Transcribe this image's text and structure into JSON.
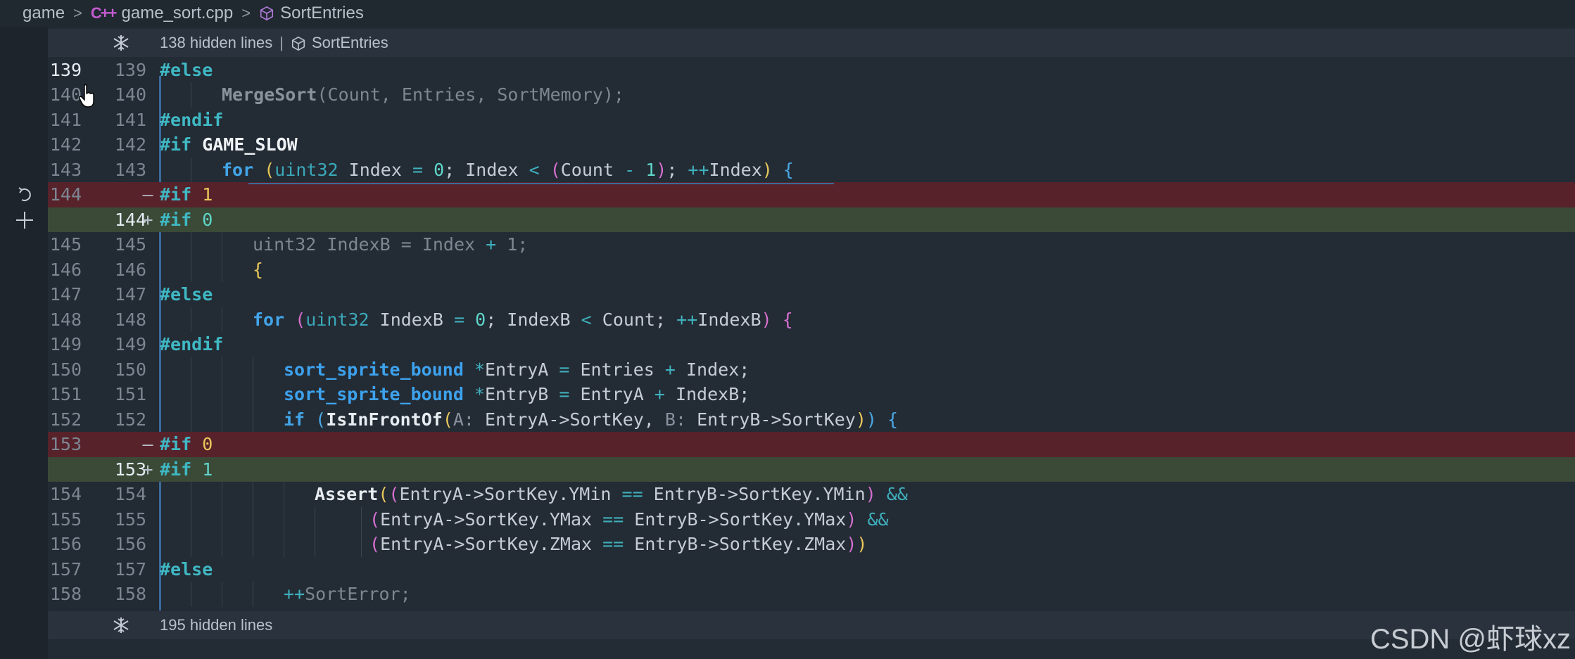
{
  "breadcrumb": {
    "folder": "game",
    "file": "game_sort.cpp",
    "file_icon": "cpp-icon",
    "symbol": "SortEntries",
    "symbol_icon": "cube-icon"
  },
  "folds": [
    {
      "count_label": "138 hidden lines",
      "symbol": "SortEntries"
    },
    {
      "count_label": "195 hidden lines"
    }
  ],
  "lines": [
    {
      "old": "139",
      "new": "139",
      "kind": "ctx",
      "active": true
    },
    {
      "old": "140",
      "new": "140",
      "kind": "ctx"
    },
    {
      "old": "141",
      "new": "141",
      "kind": "ctx"
    },
    {
      "old": "142",
      "new": "142",
      "kind": "ctx"
    },
    {
      "old": "143",
      "new": "143",
      "kind": "ctx"
    },
    {
      "old": "144",
      "new": "",
      "kind": "del",
      "mark": "—"
    },
    {
      "old": "",
      "new": "144",
      "kind": "add",
      "mark": "+"
    },
    {
      "old": "145",
      "new": "145",
      "kind": "ctx"
    },
    {
      "old": "146",
      "new": "146",
      "kind": "ctx"
    },
    {
      "old": "147",
      "new": "147",
      "kind": "ctx"
    },
    {
      "old": "148",
      "new": "148",
      "kind": "ctx"
    },
    {
      "old": "149",
      "new": "149",
      "kind": "ctx"
    },
    {
      "old": "150",
      "new": "150",
      "kind": "ctx"
    },
    {
      "old": "151",
      "new": "151",
      "kind": "ctx"
    },
    {
      "old": "152",
      "new": "152",
      "kind": "ctx"
    },
    {
      "old": "153",
      "new": "",
      "kind": "del",
      "mark": "—"
    },
    {
      "old": "",
      "new": "153",
      "kind": "add",
      "mark": "+"
    },
    {
      "old": "154",
      "new": "154",
      "kind": "ctx"
    },
    {
      "old": "155",
      "new": "155",
      "kind": "ctx"
    },
    {
      "old": "156",
      "new": "156",
      "kind": "ctx"
    },
    {
      "old": "157",
      "new": "157",
      "kind": "ctx"
    },
    {
      "old": "158",
      "new": "158",
      "kind": "ctx"
    }
  ],
  "code": {
    "l139": [
      "#else"
    ],
    "l140": [
      "MergeSort",
      "(",
      "Count, Entries, SortMemory",
      ");"
    ],
    "l141": [
      "#endif"
    ],
    "l142": [
      "#if",
      " GAME_SLOW"
    ],
    "l143": [
      "for",
      " ",
      "(",
      "uint32",
      " Index ",
      "=",
      " ",
      "0",
      "; Index ",
      "<",
      " ",
      "(",
      "Count ",
      "-",
      " ",
      "1",
      ")",
      "; ",
      "++",
      "Index",
      ")",
      " ",
      "{"
    ],
    "l144d": [
      "#if",
      " ",
      "1"
    ],
    "l144a": [
      "#if",
      " ",
      "0"
    ],
    "l145": [
      "uint32 IndexB = Index ",
      "+",
      " 1;"
    ],
    "l146": [
      "{"
    ],
    "l147": [
      "#else"
    ],
    "l148": [
      "for",
      " ",
      "(",
      "uint32",
      " IndexB ",
      "=",
      " ",
      "0",
      "; IndexB ",
      "<",
      " Count; ",
      "++",
      "IndexB",
      ")",
      " ",
      "{"
    ],
    "l149": [
      "#endif"
    ],
    "l150": [
      "sort_sprite_bound",
      " ",
      "*",
      "EntryA ",
      "=",
      " Entries ",
      "+",
      " Index;"
    ],
    "l151": [
      "sort_sprite_bound",
      " ",
      "*",
      "EntryB ",
      "=",
      " EntryA ",
      "+",
      " IndexB;"
    ],
    "l152": [
      "if",
      " ",
      "(",
      "IsInFrontOf",
      "(",
      "A:",
      " EntryA->SortKey, ",
      "B:",
      " EntryB->SortKey",
      ")",
      ")",
      " ",
      "{"
    ],
    "l153d": [
      "#if",
      " ",
      "0"
    ],
    "l153a": [
      "#if",
      " ",
      "1"
    ],
    "l154": [
      "Assert",
      "(",
      "(",
      "EntryA->SortKey.YMin ",
      "==",
      " EntryB->SortKey.YMin",
      ")",
      " ",
      "&&"
    ],
    "l155": [
      "(",
      "EntryA->SortKey.YMax ",
      "==",
      " EntryB->SortKey.YMax",
      ")",
      " ",
      "&&"
    ],
    "l156": [
      "(",
      "EntryA->SortKey.ZMax ",
      "==",
      " EntryB->SortKey.ZMax",
      ")",
      ")"
    ],
    "l157": [
      "#else"
    ],
    "l158": [
      "++",
      "SortError;"
    ]
  },
  "colors": {
    "deleted_bg": "#58222b",
    "added_bg": "#3a4a37",
    "background": "#232b34"
  },
  "icons": [
    "revert-icon",
    "plus-icon",
    "unfold-icon",
    "hand-cursor-icon"
  ],
  "watermark": "CSDN @虾球xz"
}
